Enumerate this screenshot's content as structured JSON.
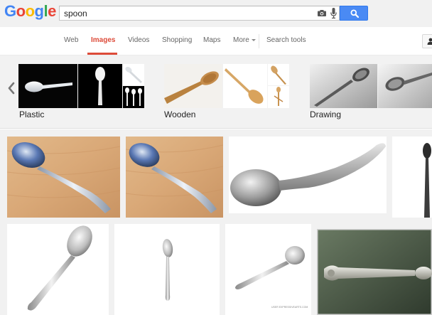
{
  "logo": {
    "letters": [
      "G",
      "o",
      "o",
      "g",
      "l",
      "e"
    ],
    "colors": [
      "#4285f4",
      "#ea4335",
      "#fbbc05",
      "#4285f4",
      "#34a853",
      "#ea4335"
    ]
  },
  "search": {
    "query": "spoon"
  },
  "icons": {
    "camera": "camera-icon",
    "mic": "microphone-icon",
    "search": "magnifier-icon",
    "account": "person-icon",
    "prev": "chevron-left-icon"
  },
  "nav": {
    "items": [
      "Web",
      "Images",
      "Videos",
      "Shopping",
      "Maps",
      "More",
      "Search tools"
    ],
    "active": "Images"
  },
  "related": {
    "clusters": [
      {
        "label": "Plastic"
      },
      {
        "label": "Wooden"
      },
      {
        "label": "Drawing"
      }
    ]
  },
  "results": {
    "watermark": "USER EXPRESSIVEARTS.COM"
  },
  "colors": {
    "accent": "#dd4b39",
    "search_button": "#4a8af4",
    "header_bg": "#f1f1f1"
  }
}
